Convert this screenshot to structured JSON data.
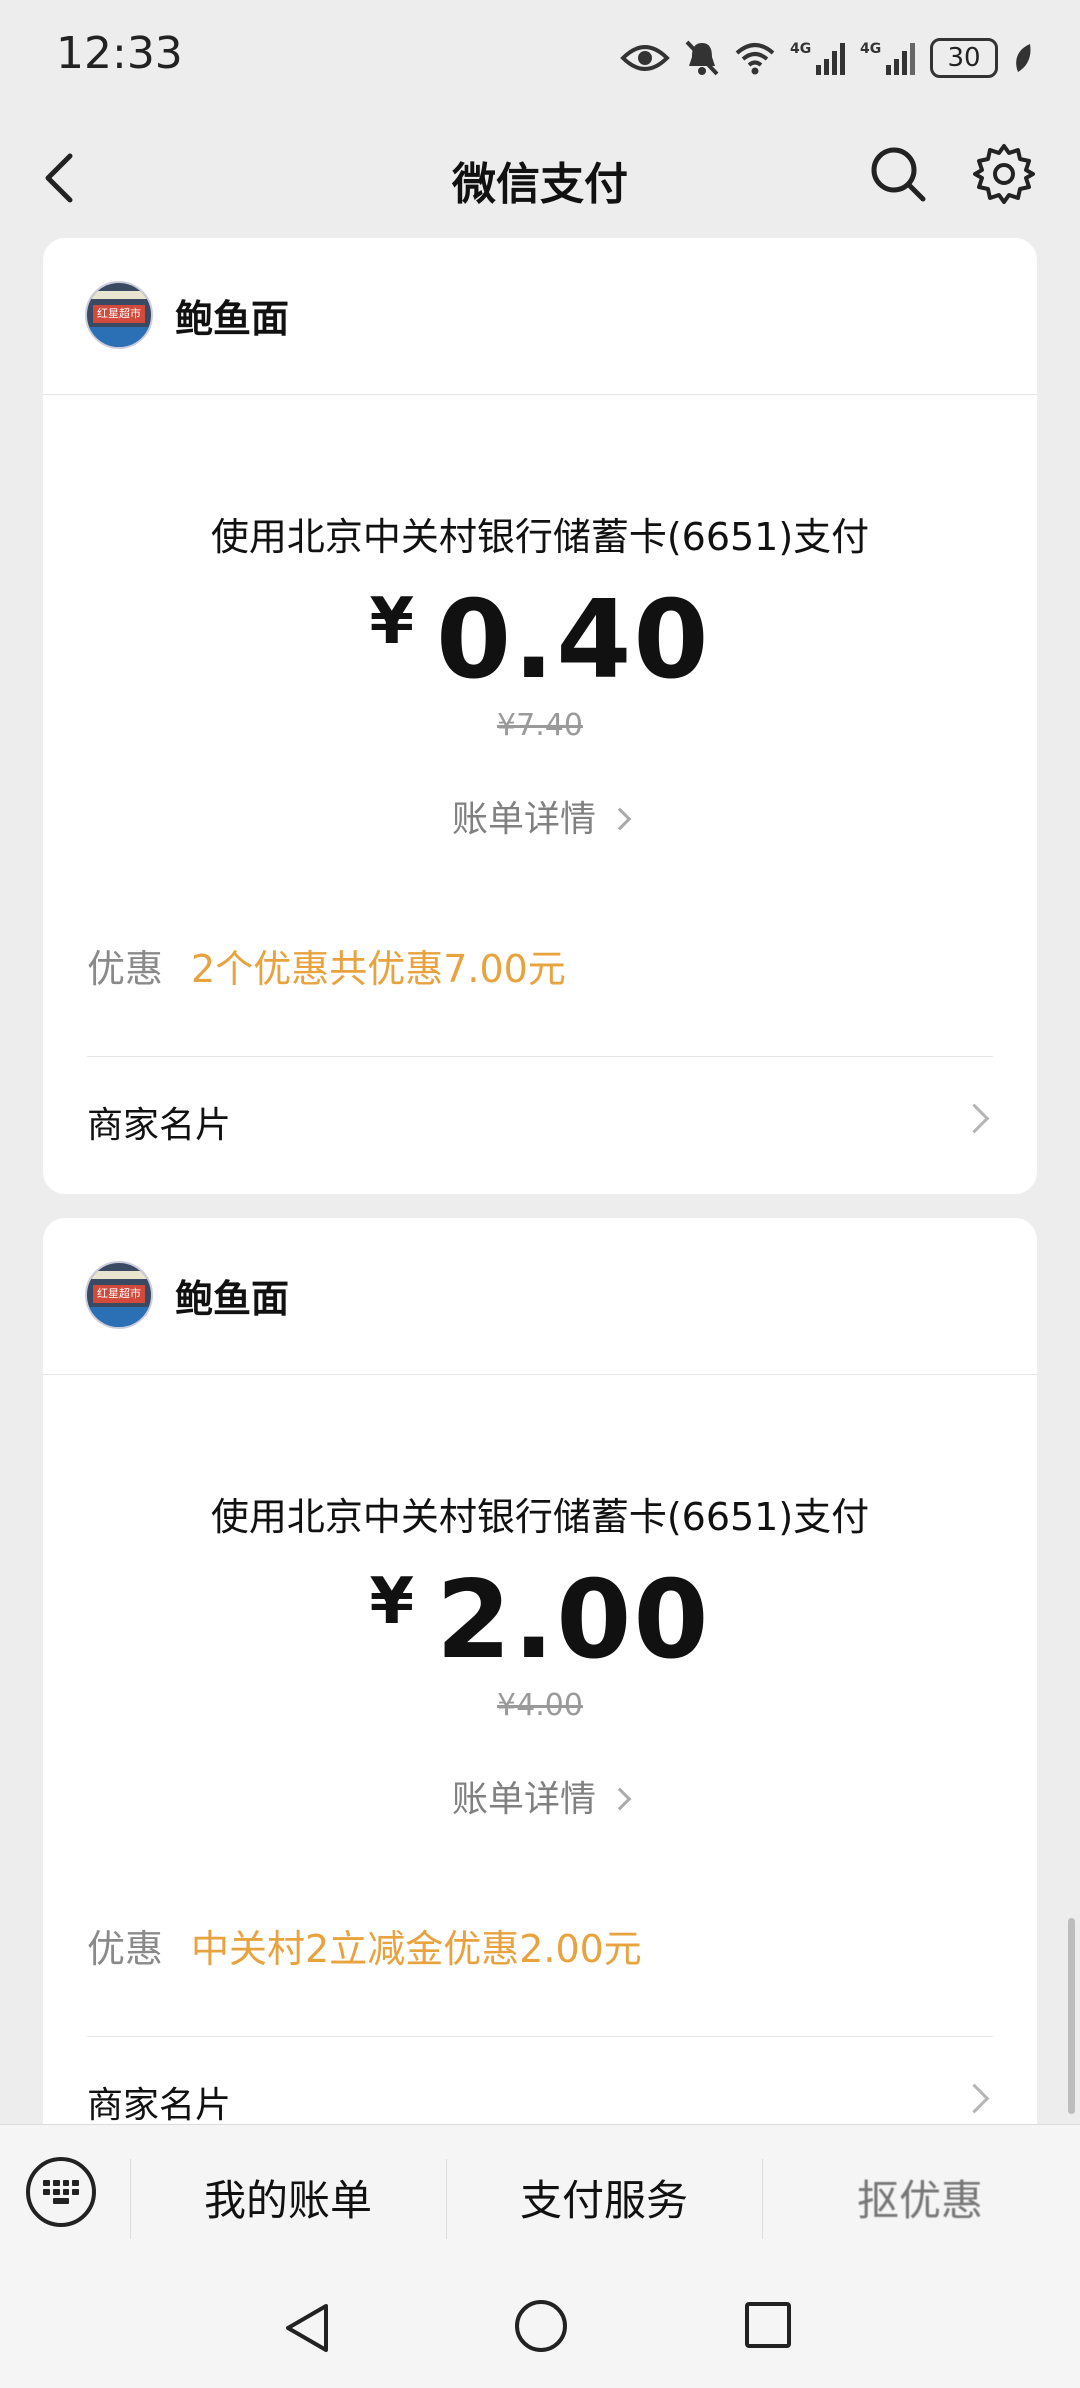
{
  "status_bar": {
    "time": "12:33",
    "battery": "30",
    "icons": [
      "eye-icon",
      "mute-bell-icon",
      "wifi-icon",
      "signal-4g-icon",
      "signal-4g-icon",
      "battery-icon",
      "leaf-icon"
    ]
  },
  "header": {
    "title": "微信支付",
    "icons": [
      "back-arrow-icon",
      "search-icon",
      "gear-icon"
    ]
  },
  "transactions": [
    {
      "merchant": "鲍鱼面",
      "avatar_text": "红星超市",
      "pay_method": "使用北京中关村银行储蓄卡(6651)支付",
      "currency": "¥",
      "amount": "0.40",
      "original_amount": "¥7.40",
      "detail_link": "账单详情",
      "discount_label": "优惠",
      "discount_text": "2个优惠共优惠7.00元",
      "merchant_card_label": "商家名片"
    },
    {
      "merchant": "鲍鱼面",
      "avatar_text": "红星超市",
      "pay_method": "使用北京中关村银行储蓄卡(6651)支付",
      "currency": "¥",
      "amount": "2.00",
      "original_amount": "¥4.00",
      "detail_link": "账单详情",
      "discount_label": "优惠",
      "discount_text": "中关村2立减金优惠2.00元",
      "merchant_card_label": "商家名片"
    }
  ],
  "bottom_nav": {
    "items": [
      "我的账单",
      "支付服务",
      "抠优惠"
    ]
  },
  "colors": {
    "background": "#ededed",
    "card": "#ffffff",
    "discount_accent": "#e8a23e",
    "muted_text": "#808080"
  }
}
